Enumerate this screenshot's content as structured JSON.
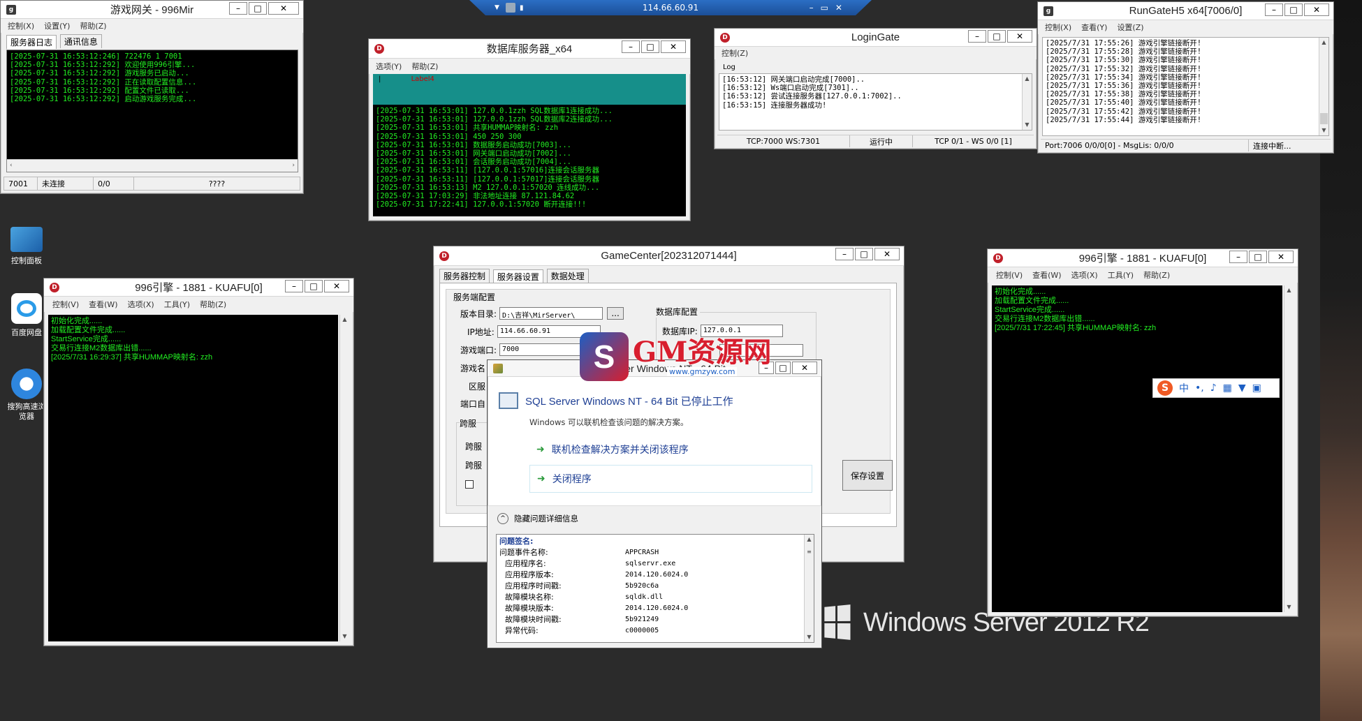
{
  "taskbar": {
    "ip": "114.66.60.91"
  },
  "desktop": {
    "icons": [
      "控制面板",
      "百度网盘",
      "搜狗高速浏览器"
    ],
    "windows_logo": "Windows Server 2012 R2"
  },
  "gw": {
    "title": "游戏网关 - 996Mir",
    "menu": [
      "控制(X)",
      "设置(Y)",
      "帮助(Z)"
    ],
    "tabs": [
      "服务器日志",
      "通讯信息"
    ],
    "log": "[2025-07-31 16:53:12:246] 722476 1 7001\n[2025-07-31 16:53:12:292] 欢迎使用996引擎...\n[2025-07-31 16:53:12:292] 游戏服务已启动...\n[2025-07-31 16:53:12:292] 正在读取配置信息...\n[2025-07-31 16:53:12:292] 配置文件已读取...\n[2025-07-31 16:53:12:292] 启动游戏服务完成...",
    "status": [
      "7001",
      "未连接",
      "0/0",
      "????"
    ]
  },
  "db": {
    "title": "数据库服务器_x64",
    "menu": [
      "选项(Y)",
      "帮助(Z)"
    ],
    "label": "Label4",
    "log": "[2025-07-31 16:53:01] 127.0.0.1zzh SQL数据库1连接成功...\n[2025-07-31 16:53:01] 127.0.0.1zzh SQL数据库2连接成功...\n[2025-07-31 16:53:01] 共享HUMMAP映射名: zzh\n[2025-07-31 16:53:01] 450 250 300\n[2025-07-31 16:53:01] 数据服务启动成功[7003]...\n[2025-07-31 16:53:01] 网关端口启动成功[7002]...\n[2025-07-31 16:53:01] 会话服务启动成功[7004]...\n[2025-07-31 16:53:11] [127.0.0.1:57016]连接会话服务器\n[2025-07-31 16:53:11] [127.0.0.1:57017]连接会话服务器\n[2025-07-31 16:53:13] M2 127.0.0.1:57020 连线成功...\n[2025-07-31 17:03:29] 非法地址连接 87.121.84.62\n[2025-07-31 17:22:41] 127.0.0.1:57020 断开连接!!!"
  },
  "lg": {
    "title": "LoginGate",
    "menu": [
      "控制(Z)"
    ],
    "group": "Log",
    "log": "[16:53:12] 网关端口启动完成[7000]..\n[16:53:12] Ws端口启动完成[7301]..\n[16:53:12] 尝试连接服务器[127.0.0.1:7002]..\n[16:53:15] 连接服务器成功!",
    "status": [
      "TCP:7000 WS:7301",
      "运行中",
      "TCP 0/1 - WS 0/0 [1]"
    ]
  },
  "rg": {
    "title": "RunGateH5 x64[7006/0]",
    "menu": [
      "控制(X)",
      "查看(Y)",
      "设置(Z)"
    ],
    "log": "[2025/7/31 17:55:26] 游戏引擎链接断开!\n[2025/7/31 17:55:28] 游戏引擎链接断开!\n[2025/7/31 17:55:30] 游戏引擎链接断开!\n[2025/7/31 17:55:32] 游戏引擎链接断开!\n[2025/7/31 17:55:34] 游戏引擎链接断开!\n[2025/7/31 17:55:36] 游戏引擎链接断开!\n[2025/7/31 17:55:38] 游戏引擎链接断开!\n[2025/7/31 17:55:40] 游戏引擎链接断开!\n[2025/7/31 17:55:42] 游戏引擎链接断开!\n[2025/7/31 17:55:44] 游戏引擎链接断开!",
    "status": [
      "Port:7006 0/0/0[0] -  MsgLis: 0/0/0",
      "连接中断..."
    ]
  },
  "e1": {
    "title": "996引擎 - 1881 - KUAFU[0]",
    "menu": [
      "控制(V)",
      "查看(W)",
      "选项(X)",
      "工具(Y)",
      "帮助(Z)"
    ],
    "log": "初始化完成......\n加载配置文件完成......\nStartService完成......\n交易行连接M2数据库出错......\n[2025/7/31 16:29:37] 共享HUMMAP映射名: zzh"
  },
  "e2": {
    "title": "996引擎 - 1881 - KUAFU[0]",
    "menu": [
      "控制(V)",
      "查看(W)",
      "选项(X)",
      "工具(Y)",
      "帮助(Z)"
    ],
    "log": "初始化完成......\n加载配置文件完成......\nStartService完成......\n交易行连接M2数据库出错......\n[2025/7/31 17:22:45] 共享HUMMAP映射名: zzh"
  },
  "gc": {
    "title": "GameCenter[202312071444]",
    "tabs": [
      "服务器控制",
      "服务器设置",
      "数据处理"
    ],
    "group1": "服务端配置",
    "group2": "数据库配置",
    "group3": "跨服",
    "labels": {
      "dir": "版本目录:",
      "ip": "IP地址:",
      "port": "游戏端口:",
      "name": "游戏名",
      "area": "区服",
      "portauto": "端口自",
      "kf1": "跨服",
      "kf2": "跨服",
      "dbip": "数据库IP:"
    },
    "values": {
      "dir": "D:\\吉祥\\MirServer\\",
      "ip": "114.66.60.91",
      "port": "7000",
      "dbip": "127.0.0.1"
    },
    "browse": "...",
    "save": "保存设置"
  },
  "sql": {
    "title": "SQL Server Windows NT - 64 Bit",
    "heading": "SQL Server Windows NT - 64 Bit 已停止工作",
    "desc": "Windows 可以联机检查该问题的解决方案。",
    "opt1": "联机检查解决方案并关闭该程序",
    "opt2": "关闭程序",
    "toggle": "隐藏问题详细信息",
    "sig_header": "问题签名:",
    "details": [
      [
        "问题事件名称:",
        "APPCRASH"
      ],
      [
        "应用程序名:",
        "sqlservr.exe"
      ],
      [
        "应用程序版本:",
        "2014.120.6024.0"
      ],
      [
        "应用程序时间戳:",
        "5b920c6a"
      ],
      [
        "故障模块名称:",
        "sqldk.dll"
      ],
      [
        "故障模块版本:",
        "2014.120.6024.0"
      ],
      [
        "故障模块时间戳:",
        "5b921249"
      ],
      [
        "异常代码:",
        "c0000005"
      ]
    ]
  },
  "watermark": {
    "brand": "GM资源网",
    "url": "www.gmzyw.com"
  },
  "ime": {
    "mode": "中"
  }
}
